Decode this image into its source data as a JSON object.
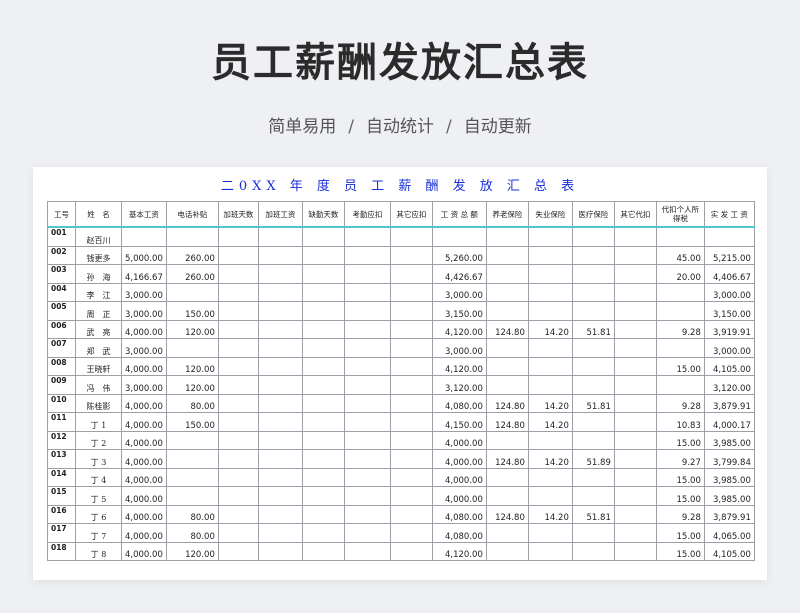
{
  "page": {
    "title": "员工薪酬发放汇总表",
    "subtitle_parts": [
      "简单易用",
      "/",
      "自动统计",
      "/",
      "自动更新"
    ]
  },
  "sheet": {
    "title": "二0XX 年 度 员 工 薪 酬 发 放 汇 总 表",
    "headers": [
      "工号",
      "姓　名",
      "基本工资",
      "电话补贴",
      "加班天数",
      "加班工资",
      "缺勤天数",
      "考勤应扣",
      "其它应扣",
      "工 资 总 额",
      "养老保险",
      "失业保险",
      "医疗保险",
      "其它代扣",
      "代扣个人所得税",
      "实 发 工 资"
    ],
    "rows": [
      [
        "001",
        "赵百川",
        "",
        "",
        "",
        "",
        "",
        "",
        "",
        "",
        "",
        "",
        "",
        "",
        "",
        ""
      ],
      [
        "002",
        "钱更多",
        "5,000.00",
        "260.00",
        "",
        "",
        "",
        "",
        "",
        "5,260.00",
        "",
        "",
        "",
        "",
        "45.00",
        "5,215.00"
      ],
      [
        "003",
        "孙　海",
        "4,166.67",
        "260.00",
        "",
        "",
        "",
        "",
        "",
        "4,426.67",
        "",
        "",
        "",
        "",
        "20.00",
        "4,406.67"
      ],
      [
        "004",
        "李　江",
        "3,000.00",
        "",
        "",
        "",
        "",
        "",
        "",
        "3,000.00",
        "",
        "",
        "",
        "",
        "",
        "3,000.00"
      ],
      [
        "005",
        "周　正",
        "3,000.00",
        "150.00",
        "",
        "",
        "",
        "",
        "",
        "3,150.00",
        "",
        "",
        "",
        "",
        "",
        "3,150.00"
      ],
      [
        "006",
        "武　亮",
        "4,000.00",
        "120.00",
        "",
        "",
        "",
        "",
        "",
        "4,120.00",
        "124.80",
        "14.20",
        "51.81",
        "",
        "9.28",
        "3,919.91"
      ],
      [
        "007",
        "郑　武",
        "3,000.00",
        "",
        "",
        "",
        "",
        "",
        "",
        "3,000.00",
        "",
        "",
        "",
        "",
        "",
        "3,000.00"
      ],
      [
        "008",
        "王晓轩",
        "4,000.00",
        "120.00",
        "",
        "",
        "",
        "",
        "",
        "4,120.00",
        "",
        "",
        "",
        "",
        "15.00",
        "4,105.00"
      ],
      [
        "009",
        "冯　伟",
        "3,000.00",
        "120.00",
        "",
        "",
        "",
        "",
        "",
        "3,120.00",
        "",
        "",
        "",
        "",
        "",
        "3,120.00"
      ],
      [
        "010",
        "陈桂影",
        "4,000.00",
        "80.00",
        "",
        "",
        "",
        "",
        "",
        "4,080.00",
        "124.80",
        "14.20",
        "51.81",
        "",
        "9.28",
        "3,879.91"
      ],
      [
        "011",
        "丁 1",
        "4,000.00",
        "150.00",
        "",
        "",
        "",
        "",
        "",
        "4,150.00",
        "124.80",
        "14.20",
        "",
        "",
        "10.83",
        "4,000.17"
      ],
      [
        "012",
        "丁 2",
        "4,000.00",
        "",
        "",
        "",
        "",
        "",
        "",
        "4,000.00",
        "",
        "",
        "",
        "",
        "15.00",
        "3,985.00"
      ],
      [
        "013",
        "丁 3",
        "4,000.00",
        "",
        "",
        "",
        "",
        "",
        "",
        "4,000.00",
        "124.80",
        "14.20",
        "51.89",
        "",
        "9.27",
        "3,799.84"
      ],
      [
        "014",
        "丁 4",
        "4,000.00",
        "",
        "",
        "",
        "",
        "",
        "",
        "4,000.00",
        "",
        "",
        "",
        "",
        "15.00",
        "3,985.00"
      ],
      [
        "015",
        "丁 5",
        "4,000.00",
        "",
        "",
        "",
        "",
        "",
        "",
        "4,000.00",
        "",
        "",
        "",
        "",
        "15.00",
        "3,985.00"
      ],
      [
        "016",
        "丁 6",
        "4,000.00",
        "80.00",
        "",
        "",
        "",
        "",
        "",
        "4,080.00",
        "124.80",
        "14.20",
        "51.81",
        "",
        "9.28",
        "3,879.91"
      ],
      [
        "017",
        "丁 7",
        "4,000.00",
        "80.00",
        "",
        "",
        "",
        "",
        "",
        "4,080.00",
        "",
        "",
        "",
        "",
        "15.00",
        "4,065.00"
      ],
      [
        "018",
        "丁 8",
        "4,000.00",
        "120.00",
        "",
        "",
        "",
        "",
        "",
        "4,120.00",
        "",
        "",
        "",
        "",
        "15.00",
        "4,105.00"
      ]
    ]
  },
  "colors": {
    "sheet_title": "#1a2fd6",
    "header_rule": "#4dc6cf"
  }
}
